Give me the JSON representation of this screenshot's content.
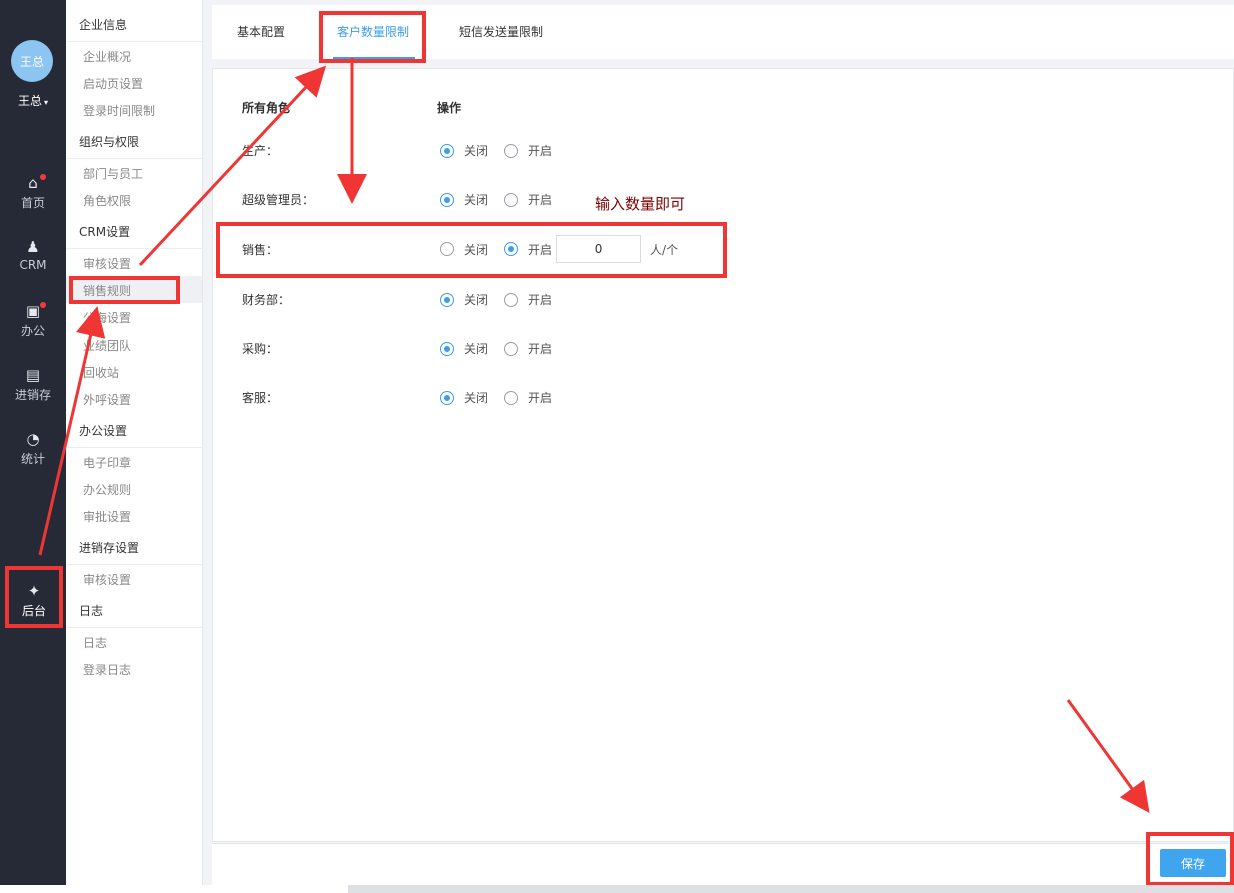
{
  "user": {
    "avatar_text": "王总",
    "name": "王总",
    "caret": "▾"
  },
  "leftnav": [
    {
      "label": "首页",
      "icon": "home-icon"
    },
    {
      "label": "CRM",
      "icon": "contacts-icon"
    },
    {
      "label": "办公",
      "icon": "briefcase-icon"
    },
    {
      "label": "进销存",
      "icon": "inventory-icon"
    },
    {
      "label": "统计",
      "icon": "pie-chart-icon"
    },
    {
      "label": "后台",
      "icon": "grid-icon"
    }
  ],
  "submenu": {
    "groups": [
      {
        "title": "企业信息",
        "items": [
          "企业概况",
          "启动页设置",
          "登录时间限制"
        ]
      },
      {
        "title": "组织与权限",
        "items": [
          "部门与员工",
          "角色权限"
        ]
      },
      {
        "title": "CRM设置",
        "items": [
          "审核设置",
          "销售规则",
          "公海设置",
          "业绩团队",
          "回收站",
          "外呼设置"
        ]
      },
      {
        "title": "办公设置",
        "items": [
          "电子印章",
          "办公规则",
          "审批设置"
        ]
      },
      {
        "title": "进销存设置",
        "items": [
          "审核设置"
        ]
      },
      {
        "title": "日志",
        "items": [
          "日志",
          "登录日志"
        ]
      }
    ]
  },
  "tabs": [
    "基本配置",
    "客户数量限制",
    "短信发送量限制"
  ],
  "table": {
    "col_role": "所有角色",
    "col_action": "操作",
    "off_label": "关闭",
    "on_label": "开启",
    "rows": [
      {
        "role": "生产：",
        "state": "off"
      },
      {
        "role": "超级管理员：",
        "state": "off"
      },
      {
        "role": "销售：",
        "state": "on",
        "value": "0",
        "unit": "人/个"
      },
      {
        "role": "财务部：",
        "state": "off"
      },
      {
        "role": "采购：",
        "state": "off"
      },
      {
        "role": "客服：",
        "state": "off"
      }
    ]
  },
  "annotation": "输入数量即可",
  "save_label": "保存",
  "colors": {
    "accent": "#3a9ee8",
    "highlight": "#f03535",
    "nav_bg": "#262a36"
  }
}
